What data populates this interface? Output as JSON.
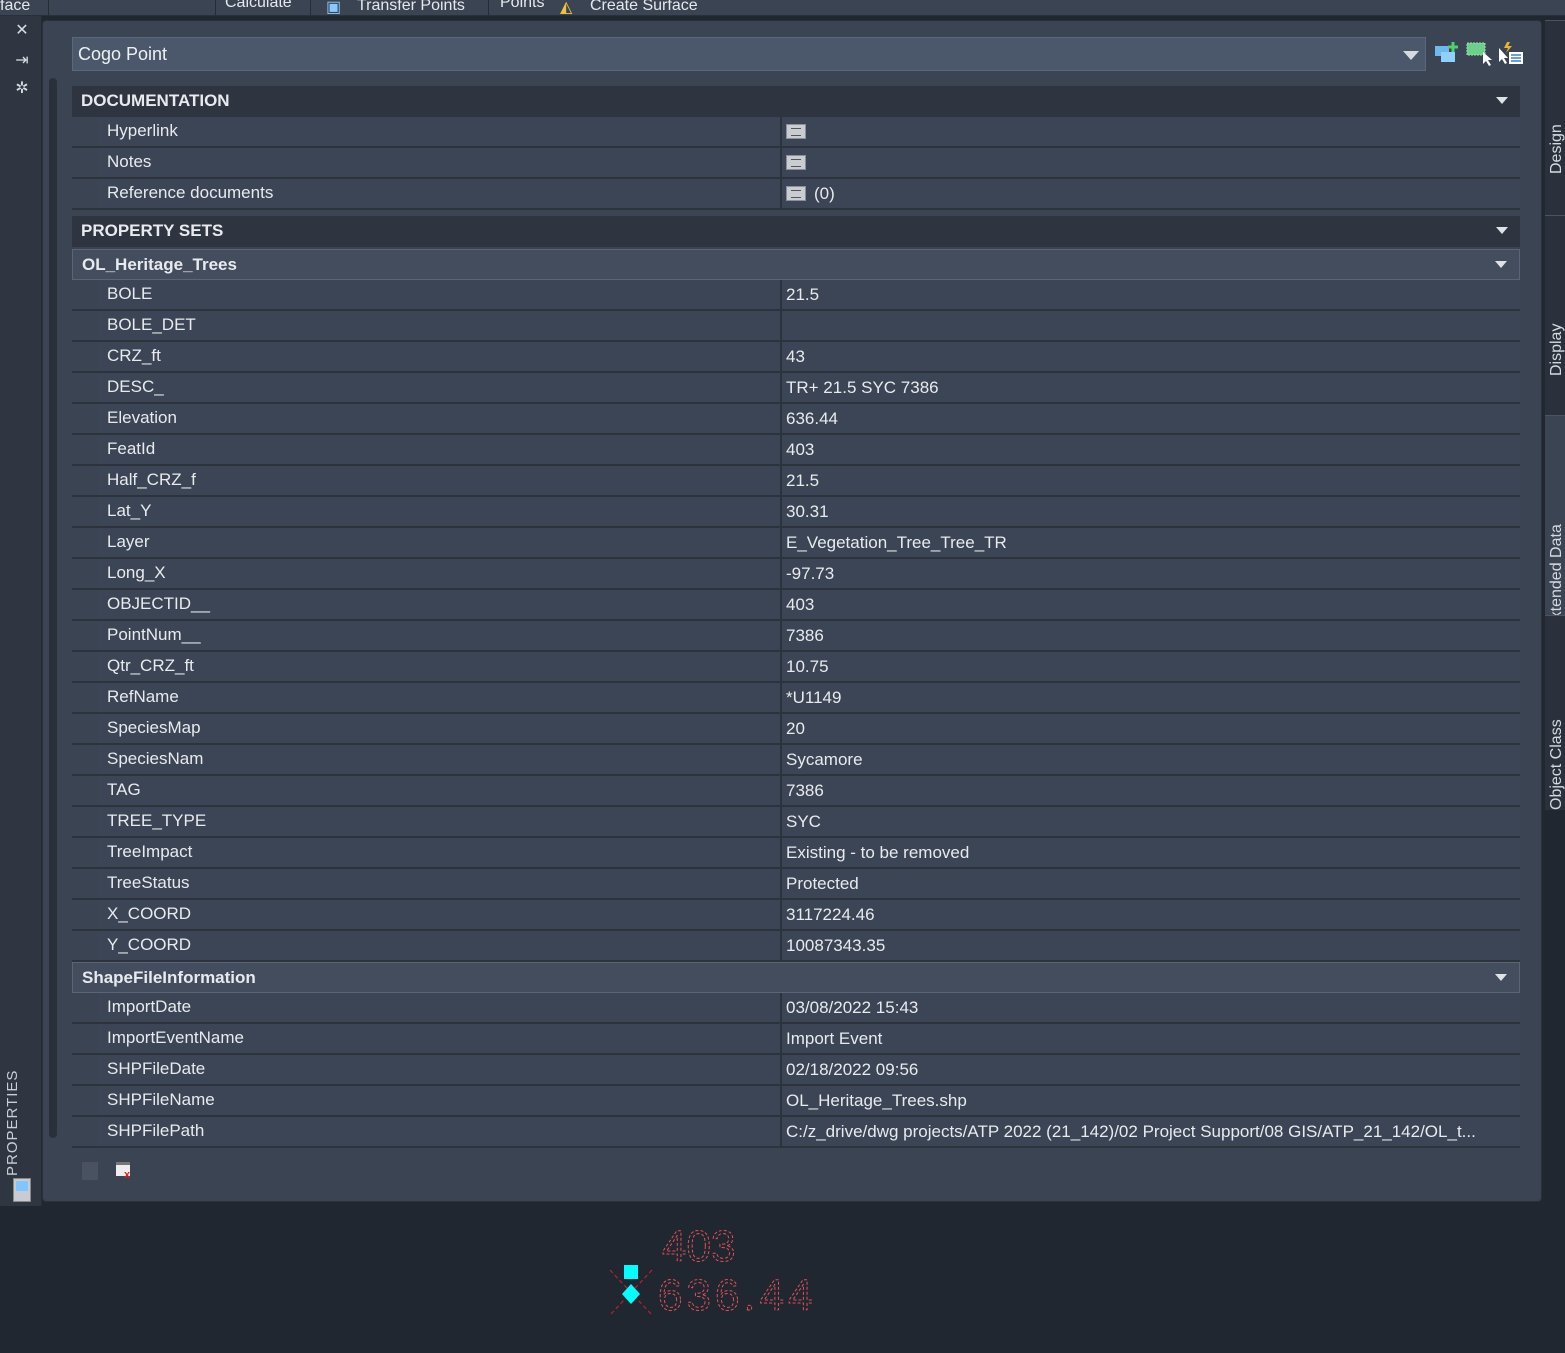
{
  "ribbon": {
    "items": [
      "face",
      "Calculate",
      "Transfer Points",
      "Points",
      "Create Surface"
    ]
  },
  "left_strip": {
    "close_icon": "close-icon",
    "autohide_icon": "autohide-icon",
    "settings_icon": "gear-icon",
    "title": "PROPERTIES"
  },
  "selector": {
    "value": "Cogo Point"
  },
  "toolbar": {
    "icons": [
      "add-to-selection-icon",
      "select-objects-icon",
      "quick-select-icon"
    ]
  },
  "sections": {
    "documentation": {
      "title": "DOCUMENTATION",
      "rows": [
        {
          "label": "Hyperlink",
          "value": "",
          "icon": true
        },
        {
          "label": "Notes",
          "value": "",
          "icon": true
        },
        {
          "label": "Reference documents",
          "value": "(0)",
          "icon": true
        }
      ]
    },
    "property_sets": {
      "title": "PROPERTY SETS"
    },
    "heritage": {
      "title": "OL_Heritage_Trees",
      "rows": [
        {
          "label": "BOLE",
          "value": "21.5"
        },
        {
          "label": "BOLE_DET",
          "value": ""
        },
        {
          "label": "CRZ_ft",
          "value": "43"
        },
        {
          "label": "DESC_",
          "value": "TR+ 21.5 SYC 7386"
        },
        {
          "label": "Elevation",
          "value": "636.44"
        },
        {
          "label": "FeatId",
          "value": "403"
        },
        {
          "label": "Half_CRZ_f",
          "value": "21.5"
        },
        {
          "label": "Lat_Y",
          "value": "30.31"
        },
        {
          "label": "Layer",
          "value": "E_Vegetation_Tree_Tree_TR"
        },
        {
          "label": "Long_X",
          "value": "-97.73"
        },
        {
          "label": "OBJECTID__",
          "value": "403"
        },
        {
          "label": "PointNum__",
          "value": "7386"
        },
        {
          "label": "Qtr_CRZ_ft",
          "value": "10.75"
        },
        {
          "label": "RefName",
          "value": "*U1149"
        },
        {
          "label": "SpeciesMap",
          "value": "20"
        },
        {
          "label": "SpeciesNam",
          "value": "Sycamore"
        },
        {
          "label": "TAG",
          "value": "7386"
        },
        {
          "label": "TREE_TYPE",
          "value": "SYC"
        },
        {
          "label": "TreeImpact",
          "value": "Existing - to be removed"
        },
        {
          "label": "TreeStatus",
          "value": "Protected"
        },
        {
          "label": "X_COORD",
          "value": "3117224.46"
        },
        {
          "label": "Y_COORD",
          "value": "10087343.35"
        }
      ]
    },
    "shapefile": {
      "title": "ShapeFileInformation",
      "rows": [
        {
          "label": "ImportDate",
          "value": "03/08/2022 15:43"
        },
        {
          "label": "ImportEventName",
          "value": "Import Event"
        },
        {
          "label": "SHPFileDate",
          "value": "02/18/2022 09:56"
        },
        {
          "label": "SHPFileName",
          "value": "OL_Heritage_Trees.shp"
        },
        {
          "label": "SHPFilePath",
          "value": "C:/z_drive/dwg projects/ATP 2022 (21_142)/02 Project Support/08 GIS/ATP_21_142/OL_t..."
        }
      ]
    }
  },
  "right_tabs": [
    {
      "label": "Design"
    },
    {
      "label": "Display"
    },
    {
      "label": "Extended Data",
      "active": true
    },
    {
      "label": "Object Class"
    }
  ],
  "drawing": {
    "point_number": "403",
    "elevation": "636.44",
    "marker_color": "#00ffff",
    "label_color": "#e0505a"
  }
}
